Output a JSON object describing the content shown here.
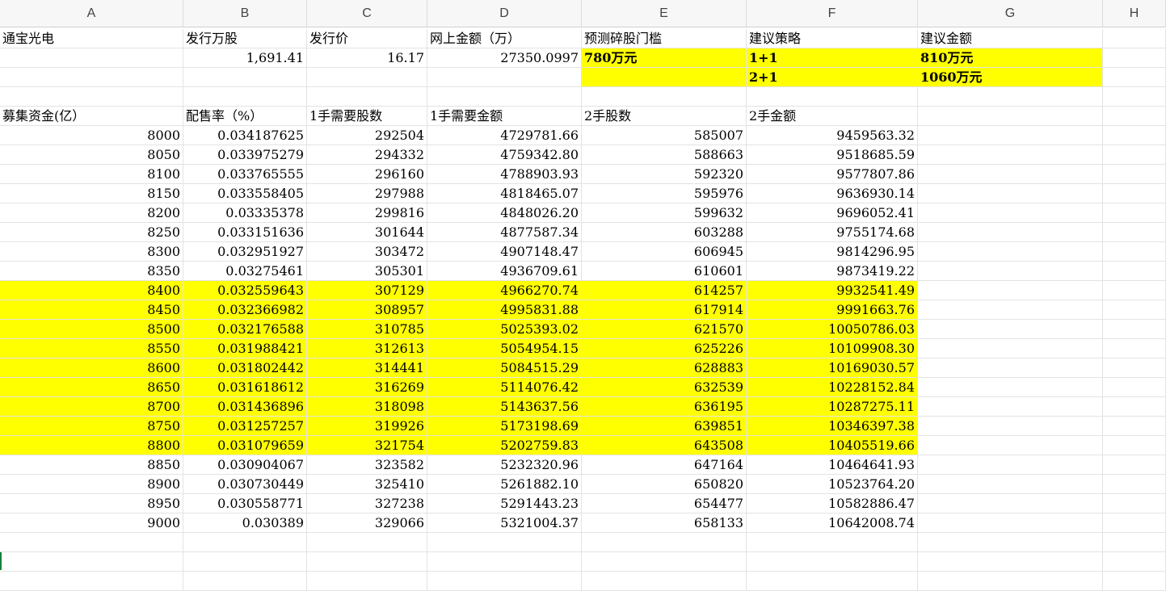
{
  "columns": [
    "A",
    "B",
    "C",
    "D",
    "E",
    "F",
    "G",
    "H"
  ],
  "row1": {
    "A": "通宝光电",
    "B": "发行万股",
    "C": "发行价",
    "D": "网上金额（万）",
    "E": "预测碎股门槛",
    "F": "建议策略",
    "G": "建议金额"
  },
  "row2": {
    "B": "1,691.41",
    "C": "16.17",
    "D": "27350.0997",
    "E": "780万元",
    "F": "1+1",
    "G": "810万元"
  },
  "row3": {
    "F": "2+1",
    "G": "1060万元"
  },
  "table_header": {
    "A": "募集资金(亿）",
    "B": "配售率（%）",
    "C": "1手需要股数",
    "D": "1手需要金额",
    "E": "2手股数",
    "F": "2手金额"
  },
  "rows": [
    [
      "8000",
      "0.034187625",
      "292504",
      "4729781.66",
      "585007",
      "9459563.32"
    ],
    [
      "8050",
      "0.033975279",
      "294332",
      "4759342.80",
      "588663",
      "9518685.59"
    ],
    [
      "8100",
      "0.033765555",
      "296160",
      "4788903.93",
      "592320",
      "9577807.86"
    ],
    [
      "8150",
      "0.033558405",
      "297988",
      "4818465.07",
      "595976",
      "9636930.14"
    ],
    [
      "8200",
      "0.03335378",
      "299816",
      "4848026.20",
      "599632",
      "9696052.41"
    ],
    [
      "8250",
      "0.033151636",
      "301644",
      "4877587.34",
      "603288",
      "9755174.68"
    ],
    [
      "8300",
      "0.032951927",
      "303472",
      "4907148.47",
      "606945",
      "9814296.95"
    ],
    [
      "8350",
      "0.03275461",
      "305301",
      "4936709.61",
      "610601",
      "9873419.22"
    ],
    [
      "8400",
      "0.032559643",
      "307129",
      "4966270.74",
      "614257",
      "9932541.49"
    ],
    [
      "8450",
      "0.032366982",
      "308957",
      "4995831.88",
      "617914",
      "9991663.76"
    ],
    [
      "8500",
      "0.032176588",
      "310785",
      "5025393.02",
      "621570",
      "10050786.03"
    ],
    [
      "8550",
      "0.031988421",
      "312613",
      "5054954.15",
      "625226",
      "10109908.30"
    ],
    [
      "8600",
      "0.031802442",
      "314441",
      "5084515.29",
      "628883",
      "10169030.57"
    ],
    [
      "8650",
      "0.031618612",
      "316269",
      "5114076.42",
      "632539",
      "10228152.84"
    ],
    [
      "8700",
      "0.031436896",
      "318098",
      "5143637.56",
      "636195",
      "10287275.11"
    ],
    [
      "8750",
      "0.031257257",
      "319926",
      "5173198.69",
      "639851",
      "10346397.38"
    ],
    [
      "8800",
      "0.031079659",
      "321754",
      "5202759.83",
      "643508",
      "10405519.66"
    ],
    [
      "8850",
      "0.030904067",
      "323582",
      "5232320.96",
      "647164",
      "10464641.93"
    ],
    [
      "8900",
      "0.030730449",
      "325410",
      "5261882.10",
      "650820",
      "10523764.20"
    ],
    [
      "8950",
      "0.030558771",
      "327238",
      "5291443.23",
      "654477",
      "10582886.47"
    ],
    [
      "9000",
      "0.030389",
      "329066",
      "5321004.37",
      "658133",
      "10642008.74"
    ]
  ],
  "highlight_rows": [
    "8400",
    "8450",
    "8500",
    "8550",
    "8600",
    "8650",
    "8700",
    "8750",
    "8800"
  ],
  "colors": {
    "highlight": "#ffff00"
  }
}
